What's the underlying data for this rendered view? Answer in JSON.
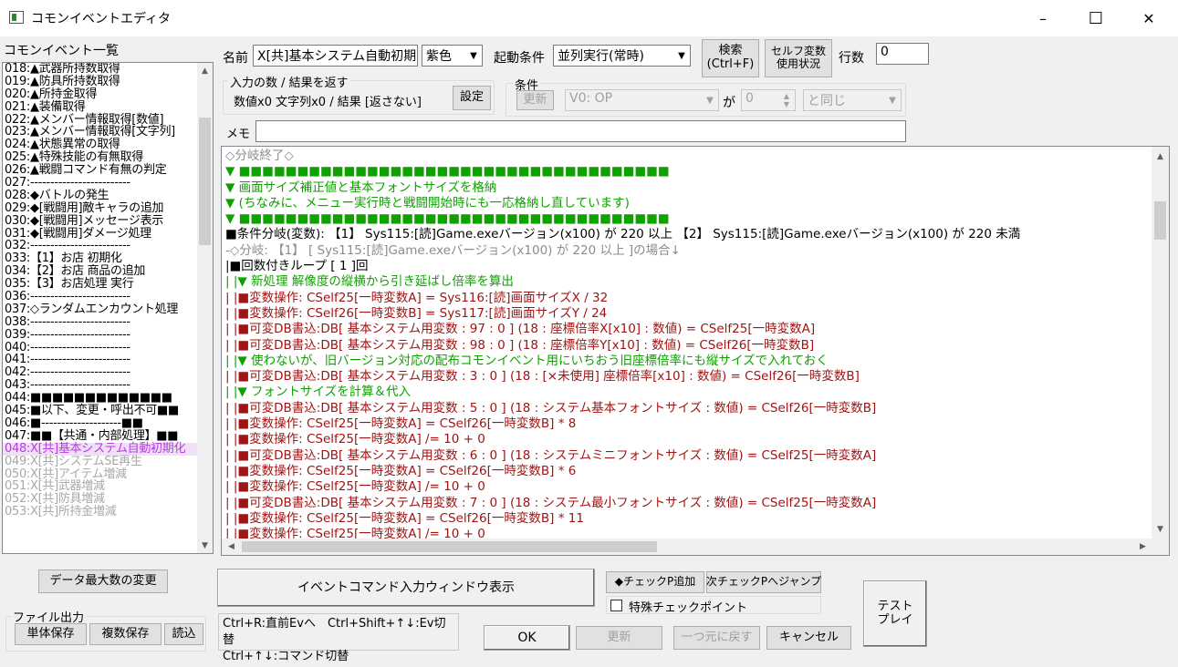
{
  "window": {
    "title": "コモンイベントエディタ",
    "minimize_glyph": "–",
    "maximize_glyph": "☐",
    "close_glyph": "✕"
  },
  "event_list": {
    "header": "コモンイベント一覧",
    "items": [
      {
        "text": "018:▲武器所持数取得",
        "state": "normal"
      },
      {
        "text": "019:▲防具所持数取得",
        "state": "normal"
      },
      {
        "text": "020:▲所持金取得",
        "state": "normal"
      },
      {
        "text": "021:▲装備取得",
        "state": "normal"
      },
      {
        "text": "022:▲メンバー情報取得[数値]",
        "state": "normal"
      },
      {
        "text": "023:▲メンバー情報取得[文字列]",
        "state": "normal"
      },
      {
        "text": "024:▲状態異常の取得",
        "state": "normal"
      },
      {
        "text": "025:▲特殊技能の有無取得",
        "state": "normal"
      },
      {
        "text": "026:▲戦闘コマンド有無の判定",
        "state": "normal"
      },
      {
        "text": "027:-------------------------",
        "state": "normal"
      },
      {
        "text": "028:◆バトルの発生",
        "state": "normal"
      },
      {
        "text": "029:◆[戦闘用]敵キャラの追加",
        "state": "normal"
      },
      {
        "text": "030:◆[戦闘用]メッセージ表示",
        "state": "normal"
      },
      {
        "text": "031:◆[戦闘用]ダメージ処理",
        "state": "normal"
      },
      {
        "text": "032:-------------------------",
        "state": "normal"
      },
      {
        "text": "033:【1】お店 初期化",
        "state": "normal"
      },
      {
        "text": "034:【2】お店 商品の追加",
        "state": "normal"
      },
      {
        "text": "035:【3】お店処理 実行",
        "state": "normal"
      },
      {
        "text": "036:-------------------------",
        "state": "normal"
      },
      {
        "text": "037:◇ランダムエンカウント処理",
        "state": "normal"
      },
      {
        "text": "038:-------------------------",
        "state": "normal"
      },
      {
        "text": "039:-------------------------",
        "state": "normal"
      },
      {
        "text": "040:-------------------------",
        "state": "normal"
      },
      {
        "text": "041:-------------------------",
        "state": "normal"
      },
      {
        "text": "042:-------------------------",
        "state": "normal"
      },
      {
        "text": "043:-------------------------",
        "state": "normal"
      },
      {
        "text": "044:■■■■■■■■■■■■■",
        "state": "normal"
      },
      {
        "text": "045:■以下、変更・呼出不可■■",
        "state": "normal"
      },
      {
        "text": "046:■--------------------■■",
        "state": "normal"
      },
      {
        "text": "047:■■【共通・内部処理】■■",
        "state": "normal"
      },
      {
        "text": "048:X[共]基本システム自動初期化",
        "state": "selected"
      },
      {
        "text": "049:X[共]システムSE再生",
        "state": "faded"
      },
      {
        "text": "050:X[共]アイテム増減",
        "state": "faded"
      },
      {
        "text": "051:X[共]武器増減",
        "state": "faded"
      },
      {
        "text": "052:X[共]防具増減",
        "state": "faded"
      },
      {
        "text": "053:X[共]所持金増減",
        "state": "faded"
      }
    ]
  },
  "header": {
    "name_label": "名前",
    "name_value": "X[共]基本システム自動初期化",
    "color_value": "紫色",
    "trigger_label": "起動条件",
    "trigger_value": "並列実行(常時)",
    "search_button": "検索\n(Ctrl+F)",
    "self_var_button": "セルフ変数\n使用状況",
    "line_count_label": "行数",
    "line_count_value": "0"
  },
  "io_group": {
    "title": "入力の数 / 結果を返す",
    "summary": "数値x0 文字列x0 / 結果 [返さない]",
    "settings_button": "設定"
  },
  "cond_group": {
    "title": "条件",
    "update_button": "更新",
    "variable_value": "V0: OP",
    "ga_label": "が",
    "number_value": "0",
    "compare_value": "と同じ"
  },
  "memo": {
    "label": "メモ",
    "value": ""
  },
  "code_lines": [
    {
      "cls": "c-gray",
      "text": "◇分岐終了◇"
    },
    {
      "cls": "c-green",
      "text": "▼ ■■■■■■■■■■■■■■■■■■■■■■■■■■■■■■■■■■■■■"
    },
    {
      "cls": "c-green",
      "text": "▼ 画面サイズ補正値と基本フォントサイズを格納"
    },
    {
      "cls": "c-green",
      "text": "▼ (ちなみに、メニュー実行時と戦闘開始時にも一応格納し直しています)"
    },
    {
      "cls": "c-green",
      "text": "▼ ■■■■■■■■■■■■■■■■■■■■■■■■■■■■■■■■■■■■■"
    },
    {
      "cls": "c-black",
      "text": "■条件分岐(変数): 【1】 Sys115:[読]Game.exeバージョン(x100)  が  220 以上 【2】 Sys115:[読]Game.exeバージョン(x100)  が  220 未満"
    },
    {
      "cls": "c-gray",
      "text": "-◇分岐: 【1】 [ Sys115:[読]Game.exeバージョン(x100)  が  220 以上 ]の場合↓"
    },
    {
      "cls": "c-black",
      "text": " |■回数付きループ [ 1 ]回"
    },
    {
      "cls": "c-green",
      "text": " | |▼ 新処理  解像度の縦横から引き延ばし倍率を算出"
    },
    {
      "cls": "c-red",
      "text": " | |■変数操作: CSelf25[一時変数A] = Sys116:[読]画面サイズX / 32"
    },
    {
      "cls": "c-red",
      "text": " | |■変数操作: CSelf26[一時変数B] = Sys117:[読]画面サイズY / 24"
    },
    {
      "cls": "c-red",
      "text": " | |■可変DB書込:DB[ 基本システム用変数 : 97 : 0 ]  (18 : 座標倍率X[x10] : 数値) =  CSelf25[一時変数A]"
    },
    {
      "cls": "c-red",
      "text": " | |■可変DB書込:DB[ 基本システム用変数 : 98 : 0 ]  (18 : 座標倍率Y[x10] : 数値) =  CSelf26[一時変数B]"
    },
    {
      "cls": "c-green",
      "text": " | |▼ 使わないが、旧バージョン対応の配布コモンイベント用にいちおう旧座標倍率にも縦サイズで入れておく"
    },
    {
      "cls": "c-red",
      "text": " | |■可変DB書込:DB[ 基本システム用変数 : 3 : 0 ]  (18 : [×未使用] 座標倍率[x10] : 数値) =  CSelf26[一時変数B]"
    },
    {
      "cls": "c-green",
      "text": " | |▼ フォントサイズを計算＆代入"
    },
    {
      "cls": "c-red",
      "text": " | |■可変DB書込:DB[ 基本システム用変数 : 5 : 0 ]  (18 : システム基本フォントサイズ : 数値) =  CSelf26[一時変数B]"
    },
    {
      "cls": "c-red",
      "text": " | |■変数操作: CSelf25[一時変数A] = CSelf26[一時変数B] * 8"
    },
    {
      "cls": "c-red",
      "text": " | |■変数操作: CSelf25[一時変数A] /= 10 + 0"
    },
    {
      "cls": "c-red",
      "text": " | |■可変DB書込:DB[ 基本システム用変数 : 6 : 0 ]  (18 : システムミニフォントサイズ : 数値) =  CSelf25[一時変数A]"
    },
    {
      "cls": "c-red",
      "text": " | |■変数操作: CSelf25[一時変数A] = CSelf26[一時変数B] * 6"
    },
    {
      "cls": "c-red",
      "text": " | |■変数操作: CSelf25[一時変数A] /= 10 + 0"
    },
    {
      "cls": "c-red",
      "text": " | |■可変DB書込:DB[ 基本システム用変数 : 7 : 0 ]  (18 : システム最小フォントサイズ : 数値) =  CSelf25[一時変数A]"
    },
    {
      "cls": "c-red",
      "text": " | |■変数操作: CSelf25[一時変数A] = CSelf26[一時変数B] * 11"
    },
    {
      "cls": "c-red",
      "text": " | |■変数操作: CSelf25[一時変数A] /= 10 + 0"
    }
  ],
  "bottom": {
    "data_max_button": "データ最大数の変更",
    "file_output_title": "ファイル出力",
    "single_save_button": "単体保存",
    "multi_save_button": "複数保存",
    "load_button": "読込",
    "command_input_button": "イベントコマンド入力ウィンドウ表示",
    "hint_line1": "Ctrl+R:直前Evへ　Ctrl+Shift+↑↓:Ev切替",
    "hint_line2": "Ctrl+↑↓:コマンド切替",
    "add_checkpoint_button": "◆チェックP追加",
    "next_checkpoint_button": "次チェックPへジャンプ",
    "special_checkpoint_label": "特殊チェックポイント",
    "ok_button": "OK",
    "update_button": "更新",
    "undo_button": "一つ元に戻す",
    "cancel_button": "キャンセル",
    "test_play_button": "テスト\nプレイ"
  }
}
